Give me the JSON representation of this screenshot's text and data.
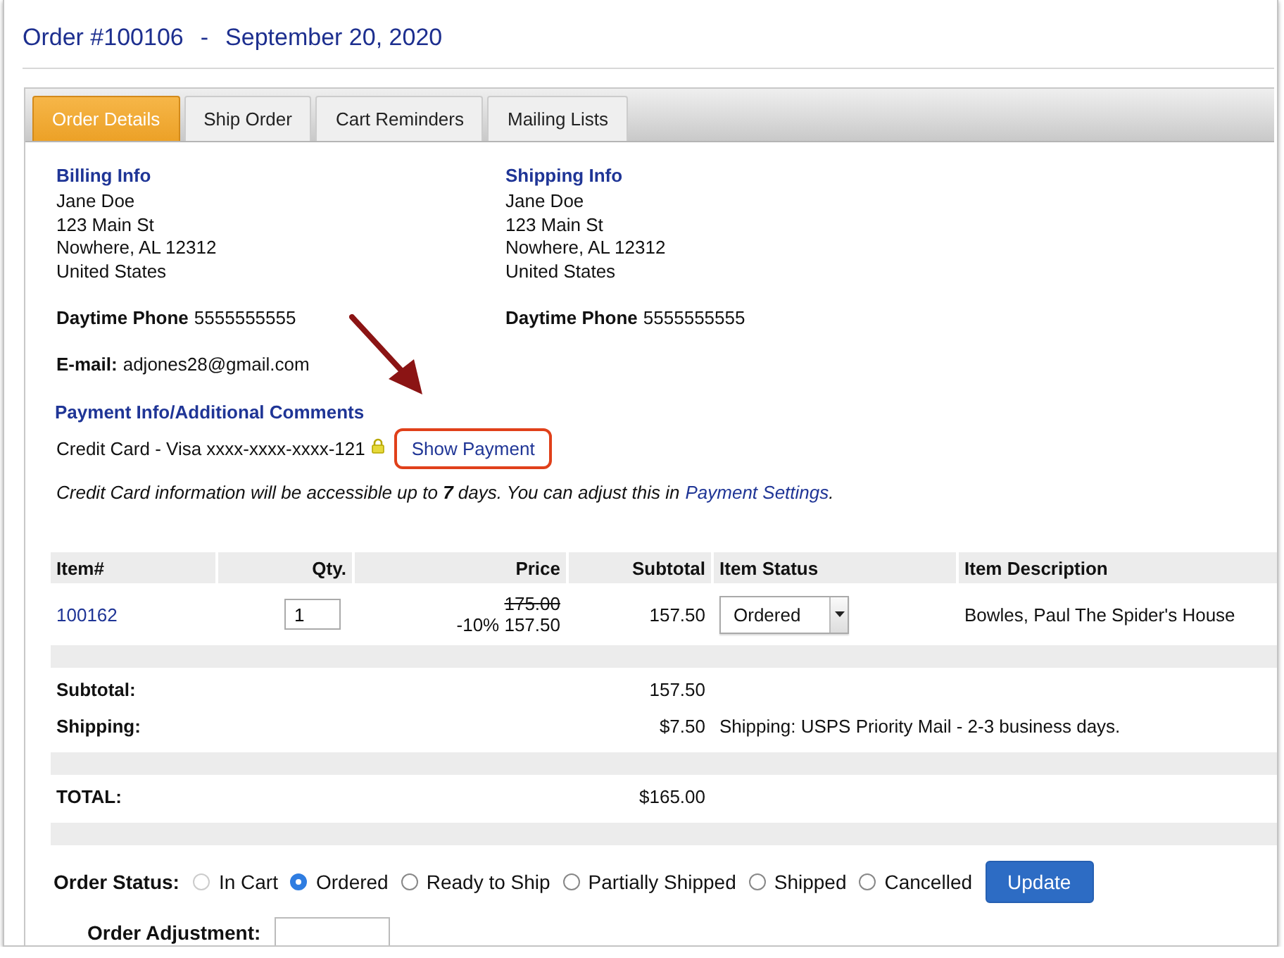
{
  "header": {
    "order": "Order #100106",
    "separator": "-",
    "date": "September 20, 2020"
  },
  "tabs": [
    {
      "label": "Order Details",
      "selected": true
    },
    {
      "label": "Ship Order",
      "selected": false
    },
    {
      "label": "Cart Reminders",
      "selected": false
    },
    {
      "label": "Mailing Lists",
      "selected": false
    }
  ],
  "addresses": [
    {
      "heading": "Billing Info",
      "lines": [
        "Jane Doe",
        "123 Main St",
        "Nowhere, AL 12312",
        "United States"
      ],
      "phone_label": "Daytime Phone",
      "phone": "5555555555",
      "email_label": "E-mail:",
      "email": "adjones28@gmail.com"
    },
    {
      "heading": "Shipping Info",
      "lines": [
        "Jane Doe",
        "123 Main St",
        "Nowhere, AL 12312",
        "United States"
      ],
      "phone_label": "Daytime Phone",
      "phone": "5555555555"
    }
  ],
  "payment": {
    "heading": "Payment Info/Additional Comments",
    "card": "Credit Card - Visa xxxx-xxxx-xxxx-121",
    "locked": true,
    "show_link": "Show Payment",
    "highlighted": true,
    "arrow": true,
    "note": "Credit Card information will be accessible up to **7** days. You can adjust this in",
    "settings_link": "Payment Settings",
    "note_end": "."
  },
  "table": {
    "columns": [
      "Item#",
      "Qty.",
      "Price",
      "Subtotal",
      "Item Status",
      "Item Description"
    ],
    "rows": [
      {
        "item": "100162",
        "qty": "1",
        "price_original": "175.00",
        "price_discounted": "-10% 157.50",
        "subtotal": "157.50",
        "status": "Ordered",
        "description": "Bowles, Paul The Spider's House"
      }
    ]
  },
  "totals": [
    {
      "label": "Subtotal:",
      "value": "157.50",
      "gap_after": false
    },
    {
      "label": "Shipping:",
      "value": "$7.50",
      "note": "Shipping: USPS Priority Mail - 2-3 business days.",
      "gap_after": true
    },
    {
      "label": "TOTAL:",
      "value": "$165.00",
      "gap_after": true
    }
  ],
  "order_status": {
    "label": "Order Status:",
    "options": [
      {
        "label": "In Cart",
        "selected": false,
        "disabled": true
      },
      {
        "label": "Ordered",
        "selected": true,
        "disabled": false
      },
      {
        "label": "Ready to Ship",
        "selected": false,
        "disabled": false
      },
      {
        "label": "Partially Shipped",
        "selected": false,
        "disabled": false
      },
      {
        "label": "Shipped",
        "selected": false,
        "disabled": false
      },
      {
        "label": "Cancelled",
        "selected": false,
        "disabled": false
      }
    ],
    "button": "Update"
  },
  "adjustment": {
    "label": "Order Adjustment:"
  }
}
